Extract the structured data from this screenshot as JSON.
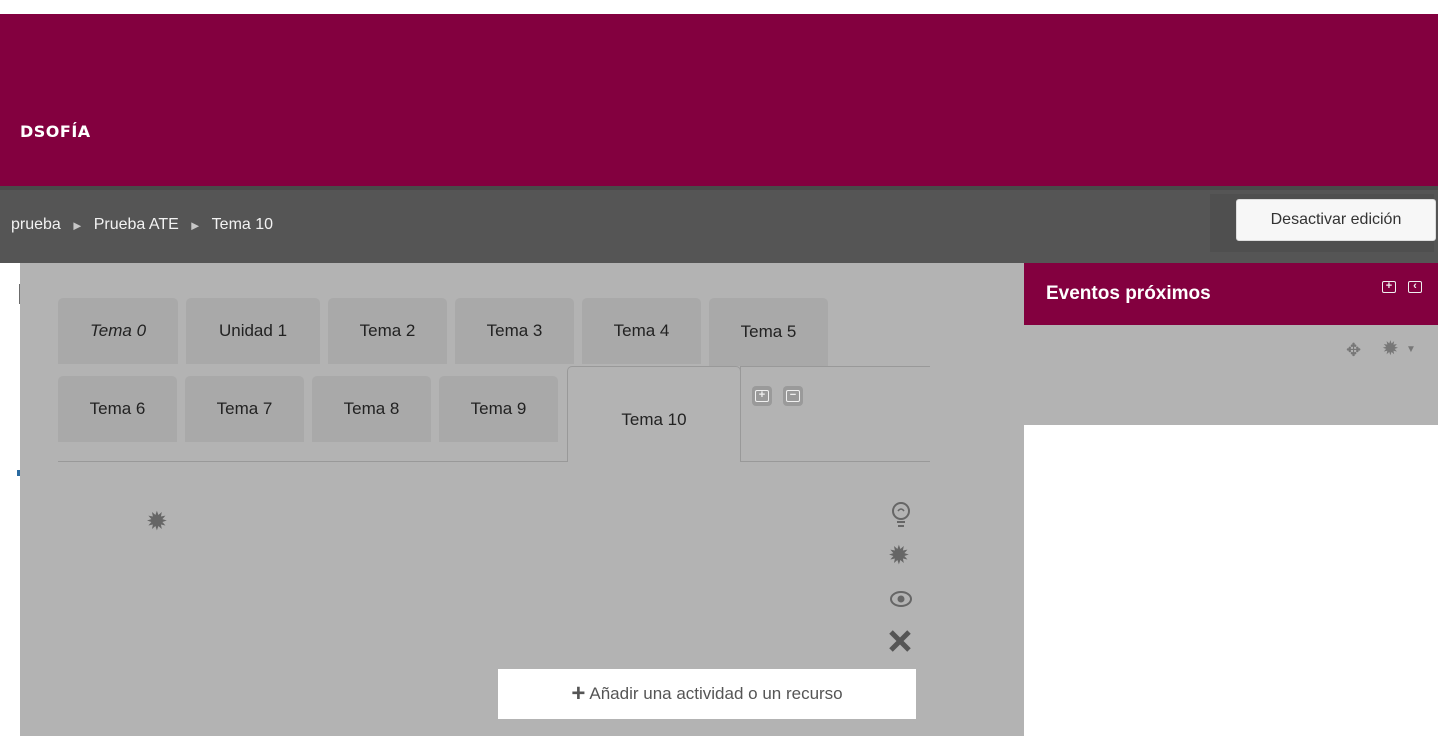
{
  "header": {
    "brand_text": "DSOFÍA",
    "color": "#83003f"
  },
  "breadcrumb": {
    "items": [
      "prueba",
      "Prueba ATE",
      "Tema 10"
    ],
    "separator": "►"
  },
  "edit_button": {
    "label": "Desactivar edición"
  },
  "tabs": {
    "row1": [
      "Tema 0",
      "Unidad 1",
      "Tema 2",
      "Tema 3",
      "Tema 4",
      "Tema 5"
    ],
    "row2": [
      "Tema 6",
      "Tema 7",
      "Tema 8",
      "Tema 9",
      "Tema 10"
    ],
    "active": "Tema 10"
  },
  "section_icons": [
    "settings-icon",
    "highlight-bulb-icon",
    "edit-settings-icon",
    "visibility-eye-icon",
    "delete-icon"
  ],
  "add_activity": {
    "label": "Añadir una actividad o un recurso"
  },
  "block": {
    "title": "Eventos próximos",
    "icons": [
      "dock-add-icon",
      "dock-collapse-icon",
      "move-icon",
      "block-settings-icon",
      "caret-down-icon"
    ]
  }
}
